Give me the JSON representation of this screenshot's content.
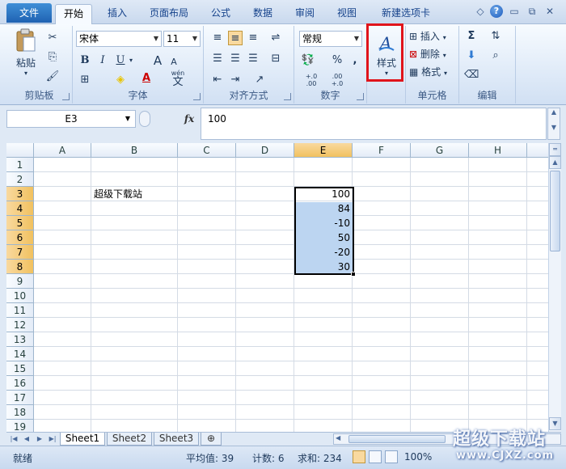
{
  "tabs": {
    "file": "文件",
    "items": [
      "开始",
      "插入",
      "页面布局",
      "公式",
      "数据",
      "审阅",
      "视图",
      "新建选项卡"
    ]
  },
  "ribbon": {
    "clipboard": {
      "label": "剪贴板",
      "paste": "粘贴"
    },
    "font": {
      "label": "字体",
      "name": "宋体",
      "size": "11",
      "bold": "B",
      "italic": "I",
      "underline": "U",
      "grow": "A",
      "shrink": "A",
      "color_letter": "A",
      "wen": "wén",
      "wen_char": "文"
    },
    "alignment": {
      "label": "对齐方式"
    },
    "number": {
      "label": "数字",
      "format": "常规",
      "percent": "%",
      "comma": ",",
      "inc_decimal": "+.0 .00",
      "dec_decimal": ".00 +.0"
    },
    "styles": {
      "label": "样式",
      "button": "样式"
    },
    "cells": {
      "label": "单元格",
      "insert": "插入",
      "delete": "删除",
      "format": "格式"
    },
    "editing": {
      "label": "编辑",
      "sum": "Σ"
    }
  },
  "formula_bar": {
    "name_box": "E3",
    "fx": "fx",
    "value": "100"
  },
  "grid": {
    "columns": [
      "A",
      "B",
      "C",
      "D",
      "E",
      "F",
      "G",
      "H"
    ],
    "rows": [
      "1",
      "2",
      "3",
      "4",
      "5",
      "6",
      "7",
      "8",
      "9",
      "10",
      "11",
      "12",
      "13",
      "14",
      "15",
      "16",
      "17",
      "18",
      "19"
    ],
    "b3": "超级下载站",
    "e_values": [
      "100",
      "84",
      "-10",
      "50",
      "-20",
      "30"
    ]
  },
  "sheets": [
    "Sheet1",
    "Sheet2",
    "Sheet3"
  ],
  "status": {
    "mode": "就绪",
    "average": "平均值: 39",
    "count": "计数: 6",
    "sum": "求和: 234",
    "zoom": "100%"
  },
  "watermark": {
    "main": "超级下载站",
    "url": "www.CJXZ.com"
  },
  "colors": {
    "selection_fill": "#bcd5f1",
    "header_selected": "#f1c15f",
    "highlight_box": "#e0141b",
    "file_tab": "#1f62b2"
  }
}
